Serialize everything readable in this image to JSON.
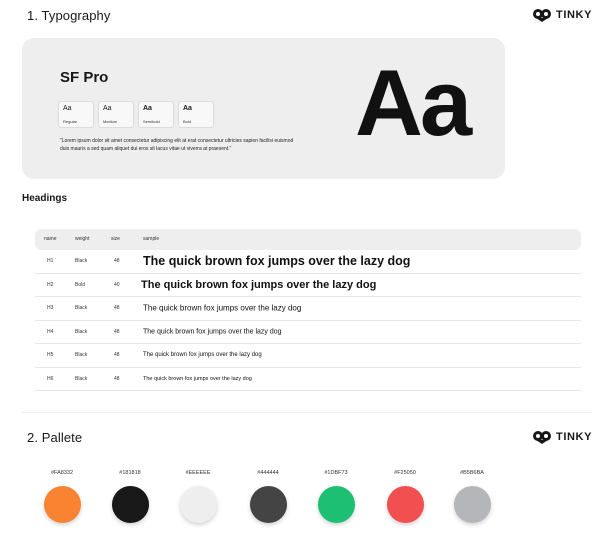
{
  "brand": {
    "name": "TINKY"
  },
  "typography": {
    "title": "1. Typography",
    "font_name": "SF Pro",
    "weights": [
      {
        "sample": "Aa",
        "label": "Regular"
      },
      {
        "sample": "Aa",
        "label": "Medium"
      },
      {
        "sample": "Aa",
        "label": "Semibold"
      },
      {
        "sample": "Aa",
        "label": "Bold"
      }
    ],
    "lorem": "\"Lorem ipsum dolor sit amet consectetur adipiscing elit at erat consectetur ultricies sapien facilisi euismod duis mauris a sed quam aliquet dui eros sit lacus vitae ut viverra at praesent.\"",
    "display_sample": "Aa"
  },
  "headings": {
    "title": "Headings",
    "columns": {
      "name": "name",
      "weight": "weight",
      "size": "size",
      "sample": "sample"
    },
    "rows": [
      {
        "name": "H1",
        "weight": "Black",
        "size": "48",
        "sample": "The quick brown fox jumps over the lazy dog"
      },
      {
        "name": "H2",
        "weight": "Bold",
        "size": "40",
        "sample": "The quick brown fox jumps over the lazy dog"
      },
      {
        "name": "H3",
        "weight": "Black",
        "size": "48",
        "sample": "The quick brown fox jumps over the lazy dog"
      },
      {
        "name": "H4",
        "weight": "Black",
        "size": "48",
        "sample": "The quick brown fox jumps over the lazy dog"
      },
      {
        "name": "H5",
        "weight": "Black",
        "size": "48",
        "sample": "The quick brown fox jumps over the lazy dog"
      },
      {
        "name": "H6",
        "weight": "Black",
        "size": "48",
        "sample": "The quick brown fox jumps over the lazy dog"
      }
    ]
  },
  "palette": {
    "title": "2. Pallete",
    "colors": [
      {
        "hex": "#FA8332",
        "color": "#FA8332"
      },
      {
        "hex": "#181818",
        "color": "#181818"
      },
      {
        "hex": "#EEEEEE",
        "color": "#EEEEEE"
      },
      {
        "hex": "#444444",
        "color": "#444444"
      },
      {
        "hex": "#1DBF73",
        "color": "#1DBF73"
      },
      {
        "hex": "#F25050",
        "color": "#F25050"
      },
      {
        "hex": "#B5B6BA",
        "color": "#B5B6BA"
      }
    ]
  }
}
